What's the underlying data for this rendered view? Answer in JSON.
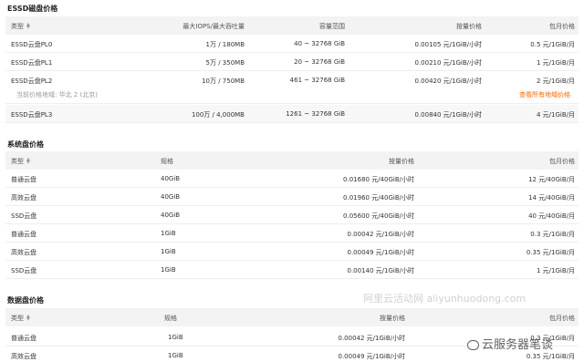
{
  "essd": {
    "title": "ESSD磁盘价格",
    "headers": [
      "类型",
      "最大IOPS/最大吞吐量",
      "容量范围",
      "按量价格",
      "包月价格"
    ],
    "rows": [
      [
        "ESSD云盘PL0",
        "1万 / 180MB",
        "40 ~ 32768 GiB",
        "0.00105 元/1GiB/小时",
        "0.5 元/1GiB/月"
      ],
      [
        "ESSD云盘PL1",
        "5万 / 350MB",
        "20 ~ 32768 GiB",
        "0.00210 元/1GiB/小时",
        "1 元/1GiB/月"
      ],
      [
        "ESSD云盘PL2",
        "10万 / 750MB",
        "461 ~ 32768 GiB",
        "0.00420 元/1GiB/小时",
        "2 元/1GiB/月"
      ],
      [
        "ESSD云盘PL3",
        "100万 / 4,000MB",
        "1261 ~ 32768 GiB",
        "0.00840 元/1GiB/小时",
        "4 元/1GiB/月"
      ]
    ],
    "note": "当前价格地域: 华北 2 (北京)",
    "view_all": "查看所有地域价格"
  },
  "system": {
    "title": "系统盘价格",
    "headers": [
      "类型",
      "规格",
      "按量价格",
      "包月价格"
    ],
    "rows": [
      [
        "普通云盘",
        "40GiB",
        "0.01680 元/40GiB/小时",
        "12 元/40GiB/月"
      ],
      [
        "高效云盘",
        "40GiB",
        "0.01960 元/40GiB/小时",
        "14 元/40GiB/月"
      ],
      [
        "SSD云盘",
        "40GiB",
        "0.05600 元/40GiB/小时",
        "40 元/40GiB/月"
      ],
      [
        "普通云盘",
        "1GiB",
        "0.00042 元/1GiB/小时",
        "0.3 元/1GiB/月"
      ],
      [
        "高效云盘",
        "1GiB",
        "0.00049 元/1GiB/小时",
        "0.35 元/1GiB/月"
      ],
      [
        "SSD云盘",
        "1GiB",
        "0.00140 元/1GiB/小时",
        "1 元/1GiB/月"
      ]
    ]
  },
  "data_disk": {
    "title": "数据盘价格",
    "headers": [
      "类型",
      "规格",
      "按量价格",
      "包月价格"
    ],
    "rows": [
      [
        "普通云盘",
        "1GiB",
        "0.00042 元/1GiB/小时",
        "0.3 元/1GiB/月"
      ],
      [
        "高效云盘",
        "1GiB",
        "0.00049 元/1GiB/小时",
        "0.35 元/1GiB/月"
      ]
    ]
  },
  "watermarks": {
    "site": "阿里云活动网 aliyunhuodong.com",
    "account": "云服务器笔谈"
  }
}
